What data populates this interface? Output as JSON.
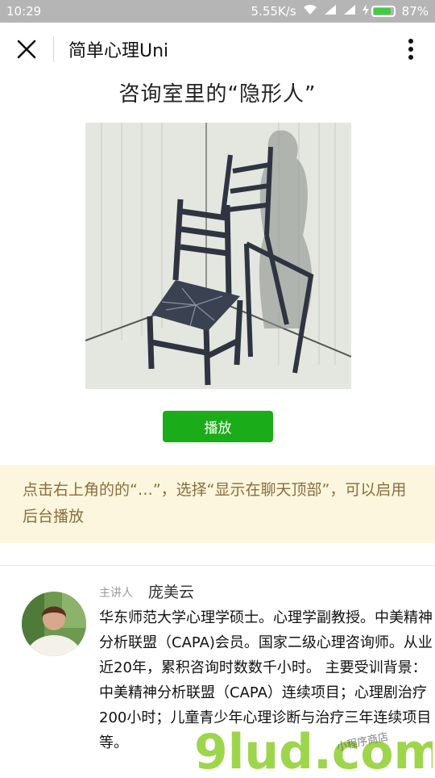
{
  "status_bar": {
    "time": "10:29",
    "network_speed": "5.55K/s",
    "battery": "87%",
    "battery_level": 0.87
  },
  "nav": {
    "title": "简单心理Uni",
    "close_icon": "close-icon",
    "more_icon": "more-vertical-icon"
  },
  "article": {
    "title": "咨询室里的“隐形人”",
    "play_label": "播放"
  },
  "tip": {
    "text": "点击右上角的的“…”，选择“显示在聊天顶部”，可以启用后台播放"
  },
  "speaker": {
    "label": "主讲人",
    "name": "庞美云",
    "bio": "华东师范大学心理学硕士。心理学副教授。中美精神分析联盟（CAPA)会员。国家二级心理咨询师。从业近20年，累积咨询时数数千小时。 主要受训背景：中美精神分析联盟（CAPA）连续项目；心理剧治疗200小时；儿童青少年心理诊断与治疗三年连续项目等。"
  },
  "watermark": {
    "logo_text": "9lud.com",
    "tagline": "小程序商店"
  },
  "colors": {
    "accent_green": "#1aad19",
    "tip_background": "#fcf6de",
    "tip_text": "#8a6d3b"
  }
}
